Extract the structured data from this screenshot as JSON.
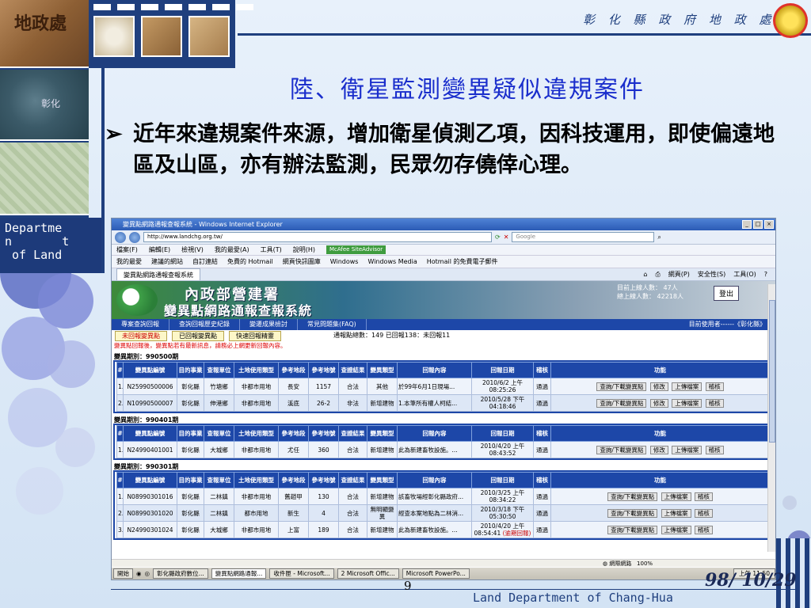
{
  "header": {
    "gov_title": "彰 化 縣 政 府 地 政 處",
    "sidebar_chars": "地政處",
    "map_label": "彰化",
    "dept_label_1": "Departme",
    "dept_label_2": "n       t",
    "dept_label_3": " of Land"
  },
  "slide": {
    "title": "陸、衛星監測變異疑似違規案件",
    "bullet_arrow": "➢",
    "bullet_text": "近年來違規案件來源，增加衛星偵測乙項，因科技運用，即使偏遠地區及山區，亦有辦法監測，民眾勿存僥倖心理。"
  },
  "browser": {
    "window_title": "變異點網路通報查報系統 - Windows Internet Explorer",
    "address": "http://www.landchg.org.tw/",
    "search_placeholder": "Google",
    "menu": [
      "檔案(F)",
      "編輯(E)",
      "檢視(V)",
      "我的最愛(A)",
      "工具(T)",
      "說明(H)"
    ],
    "mcafee": "McAfee SiteAdvisor",
    "favorites": [
      "我的最愛",
      "建議的網站",
      "自訂連結",
      "免費的 Hotmail",
      "網頁快訊圖庫",
      "Windows",
      "Windows Media",
      "Hotmail 的免費電子郵件"
    ],
    "tab_label": "變異點網路通報查報系統",
    "tools": [
      "網頁(P)",
      "安全性(S)",
      "工具(O)"
    ]
  },
  "site": {
    "agency": "內政部營建署",
    "system": "變異點網路通報查報系統",
    "online_1": "目前上線人數： 47人",
    "online_2": "總上線人數： 42218人",
    "logout": "登出",
    "nav": [
      "專案查詢回報",
      "查詢回報歷史紀錄",
      "變遷成果檢討",
      "常見問題集(FAQ)"
    ],
    "current_user": "目前使用者------《彰化縣》",
    "actions": [
      "未回報變異點",
      "已回報變異點",
      "快速回報精靈"
    ],
    "stats": "通報點總數：149 已回報138：未回報11",
    "notice": "變異點回報後，變異點若有最新訊息，請務必上網更新回報內容。"
  },
  "columns": [
    "#",
    "變異點編號",
    "目的事業",
    "查報單位",
    "土地使用類型",
    "參考地段",
    "參考地號",
    "查證結果",
    "變異類型",
    "回報內容",
    "回報日期",
    "稽核",
    "功能"
  ],
  "functions": {
    "query": "查詢/下載變異點",
    "edit": "修改",
    "upload": "上傳檔案",
    "audit": "稽核"
  },
  "periods": [
    {
      "label": "變異期別：990500期",
      "rows": [
        [
          "1.",
          "N25990500006",
          "彰化縣",
          "竹塘鄉",
          "非都市用地",
          "長安",
          "1157",
          "合法",
          "其他",
          "於99年6月1日現場...",
          "2010/6/2 上午 08:25:26",
          "通過"
        ],
        [
          "2.",
          "N10990500007",
          "彰化縣",
          "伸港鄉",
          "非都市用地",
          "溪底",
          "26-2",
          "非法",
          "新增建物",
          "1.本筆所有權人柯結...",
          "2010/5/28 下午 04:18:46",
          "通過"
        ]
      ]
    },
    {
      "label": "變異期別：990401期",
      "rows": [
        [
          "1.",
          "N24990401001",
          "彰化縣",
          "大城鄉",
          "非都市用地",
          "尤任",
          "360",
          "合法",
          "新增建物",
          "此為新建畜牧設施。...",
          "2010/4/20 上午 08:43:52",
          "通過"
        ]
      ]
    },
    {
      "label": "變異期別：990301期",
      "rows": [
        [
          "1.",
          "N08990301016",
          "彰化縣",
          "二林鎮",
          "非都市用地",
          "舊趙甲",
          "130",
          "合法",
          "新增建物",
          "該畜牧場經彰化縣政府...",
          "2010/3/25 上午 08:34:22",
          "通過"
        ],
        [
          "2.",
          "N08990301020",
          "彰化縣",
          "二林鎮",
          "都市用地",
          "新生",
          "4",
          "合法",
          "無明顯變異",
          "經查本案地點為二林消...",
          "2010/3/18 下午 05:30:50",
          "通過"
        ],
        [
          "3.",
          "N24990301024",
          "彰化縣",
          "大城鄉",
          "非都市用地",
          "上富",
          "189",
          "合法",
          "新增建物",
          "此為新建畜牧設施。...",
          "2010/4/20 上午 08:54:41",
          "通過"
        ]
      ],
      "overdue_note": "(逾期回報)"
    }
  ],
  "statusbar": "網際網路",
  "zoom": "100%",
  "taskbar": {
    "start": "開始",
    "items": [
      "彰化縣政府數位...",
      "變異點網路通報...",
      "收件匣 - Microsoft...",
      "2 Microsoft Offic...",
      "Microsoft PowerPo..."
    ],
    "clock": "上午 11:50"
  },
  "footer": {
    "page": "9",
    "date": "98/ 10/29",
    "text": "Land Department of Chang-Hua"
  }
}
